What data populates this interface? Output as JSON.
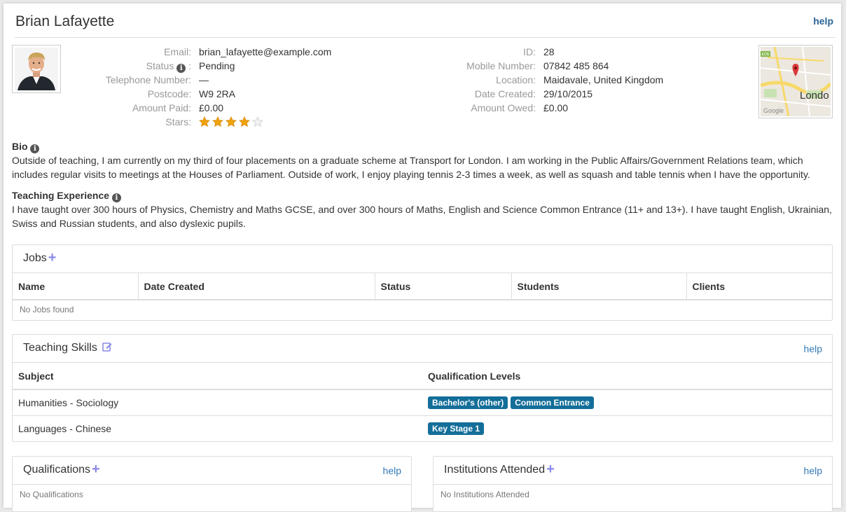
{
  "header": {
    "name": "Brian Lafayette",
    "help": "help"
  },
  "profile": {
    "left": [
      {
        "label": "Email:",
        "value": "brian_lafayette@example.com"
      },
      {
        "label": "Status",
        "value": "Pending"
      },
      {
        "label": "Telephone Number:",
        "value": "—"
      },
      {
        "label": "Postcode:",
        "value": "W9 2RA"
      },
      {
        "label": "Amount Paid:",
        "value": "£0.00"
      },
      {
        "label": "Stars:",
        "value": ""
      }
    ],
    "status_colon": ":",
    "stars": {
      "rating": 4,
      "max": 5,
      "fill_color": "#f0a30a",
      "empty_color": "#cccccc"
    },
    "right": [
      {
        "label": "ID:",
        "value": "28"
      },
      {
        "label": "Mobile Number:",
        "value": "07842 485 864"
      },
      {
        "label": "Location:",
        "value": "Maidavale, United Kingdom"
      },
      {
        "label": "Date Created:",
        "value": "29/10/2015"
      },
      {
        "label": "Amount Owed:",
        "value": "£0.00"
      }
    ],
    "map": {
      "city_label": "Londo",
      "road_shield": "406",
      "watermark": "Google"
    }
  },
  "bio": {
    "title": "Bio",
    "text": "Outside of teaching, I am currently on my third of four placements on a graduate scheme at Transport for London. I am working in the Public Affairs/Government Relations team, which includes regular visits to meetings at the Houses of Parliament. Outside of work, I enjoy playing tennis 2-3 times a week, as well as squash and table tennis when I have the opportunity."
  },
  "experience": {
    "title": "Teaching Experience",
    "text": "I have taught over 300 hours of Physics, Chemistry and Maths GCSE, and over 300 hours of Maths, English and Science Common Entrance (11+ and 13+). I have taught English, Ukrainian, Swiss and Russian students, and also dyslexic pupils."
  },
  "jobs": {
    "title": "Jobs",
    "columns": [
      "Name",
      "Date Created",
      "Status",
      "Students",
      "Clients"
    ],
    "empty": "No Jobs found"
  },
  "skills": {
    "title": "Teaching Skills",
    "help": "help",
    "columns": [
      "Subject",
      "Qualification Levels"
    ],
    "rows": [
      {
        "subject": "Humanities - Sociology",
        "levels": [
          "Bachelor's (other)",
          "Common Entrance"
        ]
      },
      {
        "subject": "Languages - Chinese",
        "levels": [
          "Key Stage 1"
        ]
      }
    ]
  },
  "qualifications": {
    "title": "Qualifications",
    "help": "help",
    "empty": "No Qualifications"
  },
  "institutions": {
    "title": "Institutions Attended",
    "help": "help",
    "empty": "No Institutions Attended"
  },
  "colors": {
    "accent": "#337ab7",
    "badge": "#136e99",
    "plus": "#8a8ae8"
  }
}
